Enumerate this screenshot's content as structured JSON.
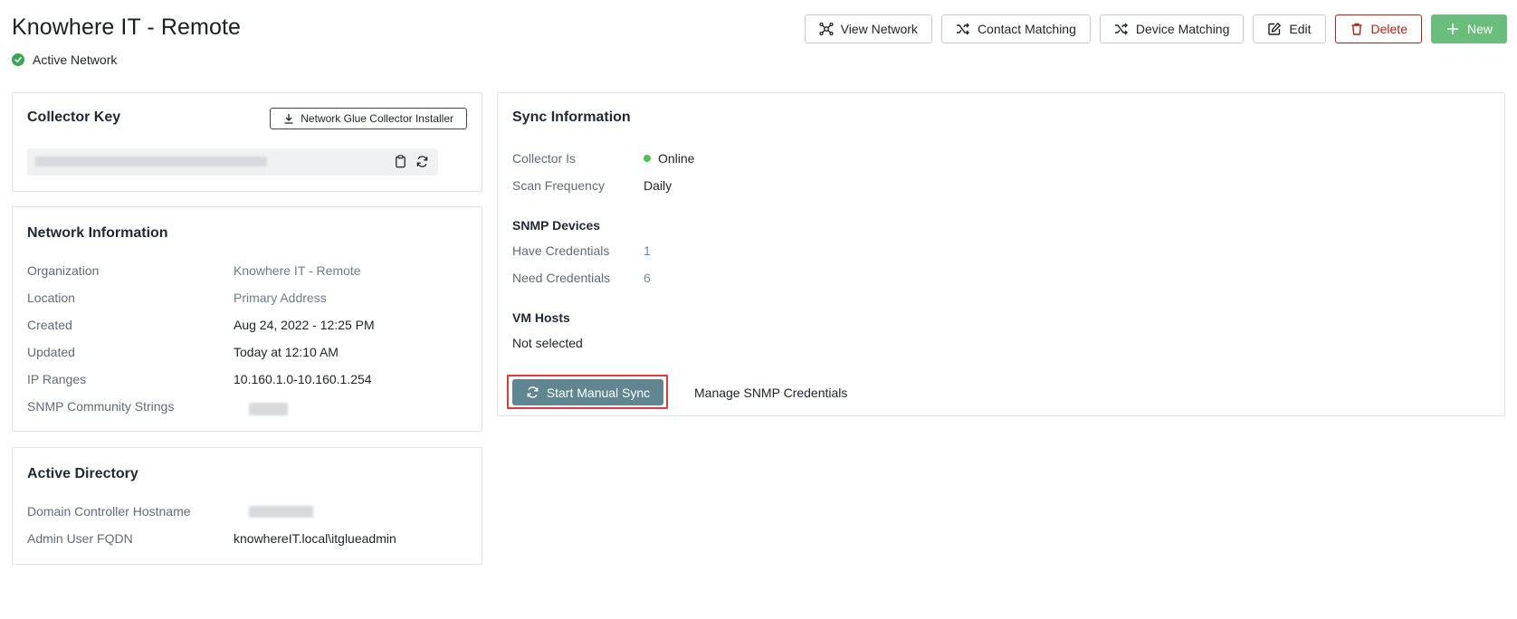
{
  "header": {
    "title": "Knowhere IT - Remote",
    "status": "Active Network"
  },
  "toolbar": {
    "view_network": "View Network",
    "contact_matching": "Contact Matching",
    "device_matching": "Device Matching",
    "edit": "Edit",
    "delete": "Delete",
    "new": "New"
  },
  "collector_key": {
    "title": "Collector Key",
    "installer_button": "Network Glue Collector Installer"
  },
  "network_info": {
    "title": "Network Information",
    "rows": [
      {
        "label": "Organization",
        "value": "Knowhere IT - Remote"
      },
      {
        "label": "Location",
        "value": "Primary Address"
      },
      {
        "label": "Created",
        "value": "Aug 24, 2022 - 12:25 PM"
      },
      {
        "label": "Updated",
        "value": "Today at 12:10 AM"
      },
      {
        "label": "IP Ranges",
        "value": "10.160.1.0-10.160.1.254"
      },
      {
        "label": "SNMP Community Strings",
        "value": ""
      }
    ]
  },
  "active_directory": {
    "title": "Active Directory",
    "rows": [
      {
        "label": "Domain Controller Hostname",
        "value": ""
      },
      {
        "label": "Admin User FQDN",
        "value": "knowhereIT.local\\itglueadmin"
      }
    ]
  },
  "sync": {
    "title": "Sync Information",
    "collector_label": "Collector Is",
    "collector_value": "Online",
    "scan_label": "Scan Frequency",
    "scan_value": "Daily",
    "snmp_heading": "SNMP Devices",
    "have_label": "Have Credentials",
    "have_value": "1",
    "need_label": "Need Credentials",
    "need_value": "6",
    "vm_heading": "VM Hosts",
    "vm_value": "Not selected",
    "start_button": "Start Manual Sync",
    "manage_link": "Manage SNMP Credentials"
  },
  "colors": {
    "accent_green": "#6bbd7d",
    "delete_red": "#b42318",
    "sync_button": "#5f8691",
    "highlight_red": "#e53935",
    "online": "#4cc34c"
  }
}
